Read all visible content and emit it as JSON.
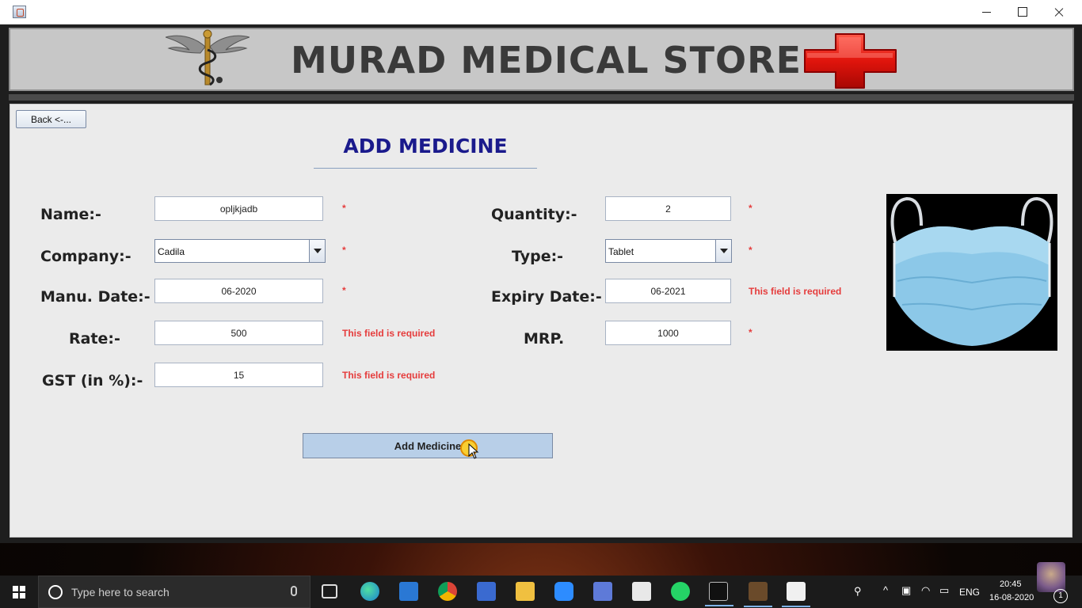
{
  "window": {
    "buttons": {
      "minimize": "minimize-icon",
      "maximize": "maximize-icon",
      "close": "close-icon"
    }
  },
  "banner": {
    "title": "MURAD MEDICAL STORE",
    "logo": "caduceus-icon",
    "symbol": "red-cross-icon"
  },
  "form": {
    "back_label": "Back <-...",
    "title": "ADD MEDICINE",
    "labels": {
      "name": "Name:-",
      "company": "Company:-",
      "manu_date": "Manu. Date:-",
      "rate": "Rate:-",
      "gst": "GST (in %):-",
      "quantity": "Quantity:-",
      "type": "Type:-",
      "expiry_date": "Expiry Date:-",
      "mrp": "MRP."
    },
    "values": {
      "name": "opljkjadb",
      "company": "Cadila",
      "manu_date": "06-2020",
      "rate": "500",
      "gst": "15",
      "quantity": "2",
      "type": "Tablet",
      "expiry_date": "06-2021",
      "mrp": "1000"
    },
    "required_marker": "*",
    "required_message": "This field is required",
    "submit_label": "Add Medicine",
    "image": "face-mask-image"
  },
  "taskbar": {
    "search_placeholder": "Type here to search",
    "apps": [
      "task-view-icon",
      "edge-icon",
      "mail-icon",
      "chrome-icon",
      "camera-app-icon",
      "file-explorer-icon",
      "zoom-icon",
      "paint-icon",
      "store-icon",
      "whatsapp-icon",
      "terminal-icon",
      "game-icon",
      "java-icon"
    ],
    "language": "ENG",
    "time": "20:45",
    "date": "16-08-2020",
    "notifications": "1"
  },
  "colors": {
    "title_blue": "#1a1a8c",
    "required_red": "#e53c3c",
    "button_blue": "#b8cfe8",
    "banner_grey": "#c7c7c7"
  }
}
